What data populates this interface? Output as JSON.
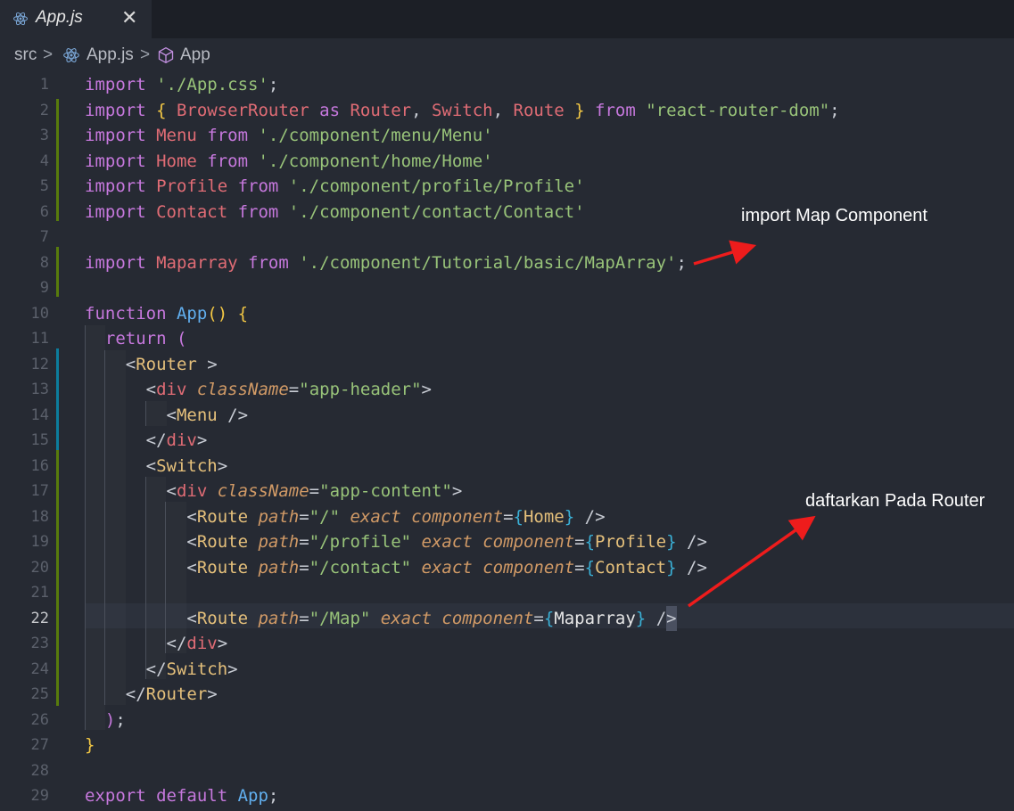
{
  "tab": {
    "label": "App.js",
    "close": "✕"
  },
  "breadcrumb": {
    "items": [
      "src",
      "App.js",
      "App"
    ],
    "separator": ">"
  },
  "editor": {
    "active_line": 22,
    "lines": [
      {
        "n": "1",
        "tokens": [
          [
            "kw",
            "import "
          ],
          [
            "str",
            "'./App.css'"
          ],
          [
            "pu",
            ";"
          ]
        ]
      },
      {
        "n": "2",
        "tokens": [
          [
            "kw",
            "import "
          ],
          [
            "br",
            "{ "
          ],
          [
            "id",
            "BrowserRouter "
          ],
          [
            "kw",
            "as "
          ],
          [
            "id",
            "Router"
          ],
          [
            "pu",
            ", "
          ],
          [
            "id",
            "Switch"
          ],
          [
            "pu",
            ", "
          ],
          [
            "id",
            "Route "
          ],
          [
            "br",
            "} "
          ],
          [
            "kw",
            "from "
          ],
          [
            "str",
            "\"react-router-dom\""
          ],
          [
            "pu",
            ";"
          ]
        ]
      },
      {
        "n": "3",
        "tokens": [
          [
            "kw",
            "import "
          ],
          [
            "id",
            "Menu "
          ],
          [
            "kw",
            "from "
          ],
          [
            "str",
            "'./component/menu/Menu'"
          ]
        ]
      },
      {
        "n": "4",
        "tokens": [
          [
            "kw",
            "import "
          ],
          [
            "id",
            "Home "
          ],
          [
            "kw",
            "from "
          ],
          [
            "str",
            "'./component/home/Home'"
          ]
        ]
      },
      {
        "n": "5",
        "tokens": [
          [
            "kw",
            "import "
          ],
          [
            "id",
            "Profile "
          ],
          [
            "kw",
            "from "
          ],
          [
            "str",
            "'./component/profile/Profile'"
          ]
        ]
      },
      {
        "n": "6",
        "tokens": [
          [
            "kw",
            "import "
          ],
          [
            "id",
            "Contact "
          ],
          [
            "kw",
            "from "
          ],
          [
            "str",
            "'./component/contact/Contact'"
          ]
        ]
      },
      {
        "n": "7",
        "tokens": []
      },
      {
        "n": "8",
        "tokens": [
          [
            "kw",
            "import "
          ],
          [
            "id",
            "Maparray "
          ],
          [
            "kw",
            "from "
          ],
          [
            "str",
            "'./component/Tutorial/basic/MapArray'"
          ],
          [
            "pu",
            ";"
          ]
        ]
      },
      {
        "n": "9",
        "tokens": []
      },
      {
        "n": "10",
        "tokens": [
          [
            "kw",
            "function "
          ],
          [
            "fn",
            "App"
          ],
          [
            "br",
            "() {"
          ]
        ]
      },
      {
        "n": "11",
        "tokens": [
          [
            "pu",
            "  "
          ],
          [
            "kw",
            "return ("
          ]
        ]
      },
      {
        "n": "12",
        "tokens": [
          [
            "pu",
            "    <"
          ],
          [
            "tag",
            "Router "
          ],
          [
            "pu",
            ">"
          ]
        ]
      },
      {
        "n": "13",
        "tokens": [
          [
            "pu",
            "      <"
          ],
          [
            "id",
            "div "
          ],
          [
            "attr",
            "className"
          ],
          [
            "pu",
            "="
          ],
          [
            "str",
            "\"app-header\""
          ],
          [
            "pu",
            ">"
          ]
        ]
      },
      {
        "n": "14",
        "tokens": [
          [
            "pu",
            "        <"
          ],
          [
            "tag",
            "Menu "
          ],
          [
            "pu",
            "/>"
          ]
        ]
      },
      {
        "n": "15",
        "tokens": [
          [
            "pu",
            "      </"
          ],
          [
            "id",
            "div"
          ],
          [
            "pu",
            ">"
          ]
        ]
      },
      {
        "n": "16",
        "tokens": [
          [
            "pu",
            "      <"
          ],
          [
            "tag",
            "Switch"
          ],
          [
            "pu",
            ">"
          ]
        ]
      },
      {
        "n": "17",
        "tokens": [
          [
            "pu",
            "        <"
          ],
          [
            "id",
            "div "
          ],
          [
            "attr",
            "className"
          ],
          [
            "pu",
            "="
          ],
          [
            "str",
            "\"app-content\""
          ],
          [
            "pu",
            ">"
          ]
        ]
      },
      {
        "n": "18",
        "tokens": [
          [
            "pu",
            "          <"
          ],
          [
            "tag",
            "Route "
          ],
          [
            "attr",
            "path"
          ],
          [
            "pu",
            "="
          ],
          [
            "str",
            "\"/\" "
          ],
          [
            "attr",
            "exact "
          ],
          [
            "attr",
            "component"
          ],
          [
            "pu",
            "="
          ],
          [
            "cbr",
            "{"
          ],
          [
            "tag",
            "Home"
          ],
          [
            "cbr",
            "}"
          ],
          [
            "pu",
            " />"
          ]
        ]
      },
      {
        "n": "19",
        "tokens": [
          [
            "pu",
            "          <"
          ],
          [
            "tag",
            "Route "
          ],
          [
            "attr",
            "path"
          ],
          [
            "pu",
            "="
          ],
          [
            "str",
            "\"/profile\" "
          ],
          [
            "attr",
            "exact "
          ],
          [
            "attr",
            "component"
          ],
          [
            "pu",
            "="
          ],
          [
            "cbr",
            "{"
          ],
          [
            "tag",
            "Profile"
          ],
          [
            "cbr",
            "}"
          ],
          [
            "pu",
            " />"
          ]
        ]
      },
      {
        "n": "20",
        "tokens": [
          [
            "pu",
            "          <"
          ],
          [
            "tag",
            "Route "
          ],
          [
            "attr",
            "path"
          ],
          [
            "pu",
            "="
          ],
          [
            "str",
            "\"/contact\" "
          ],
          [
            "attr",
            "exact "
          ],
          [
            "attr",
            "component"
          ],
          [
            "pu",
            "="
          ],
          [
            "cbr",
            "{"
          ],
          [
            "tag",
            "Contact"
          ],
          [
            "cbr",
            "}"
          ],
          [
            "pu",
            " />"
          ]
        ]
      },
      {
        "n": "21",
        "tokens": []
      },
      {
        "n": "22",
        "tokens": [
          [
            "pu",
            "          <"
          ],
          [
            "tag",
            "Route "
          ],
          [
            "attr",
            "path"
          ],
          [
            "pu",
            "="
          ],
          [
            "str",
            "\"/Map\" "
          ],
          [
            "attr",
            "exact "
          ],
          [
            "attr",
            "component"
          ],
          [
            "pu",
            "="
          ],
          [
            "cbr",
            "{"
          ],
          [
            "mp",
            "Maparray"
          ],
          [
            "cbr",
            "}"
          ],
          [
            "pu",
            " /"
          ],
          [
            "cursor",
            ">"
          ]
        ]
      },
      {
        "n": "23",
        "tokens": [
          [
            "pu",
            "        </"
          ],
          [
            "id",
            "div"
          ],
          [
            "pu",
            ">"
          ]
        ]
      },
      {
        "n": "24",
        "tokens": [
          [
            "pu",
            "      </"
          ],
          [
            "tag",
            "Switch"
          ],
          [
            "pu",
            ">"
          ]
        ]
      },
      {
        "n": "25",
        "tokens": [
          [
            "pu",
            "    </"
          ],
          [
            "tag",
            "Router"
          ],
          [
            "pu",
            ">"
          ]
        ]
      },
      {
        "n": "26",
        "tokens": [
          [
            "pu",
            "  "
          ],
          [
            "kw",
            ")"
          ],
          [
            "pu",
            ";"
          ]
        ]
      },
      {
        "n": "27",
        "tokens": [
          [
            "br",
            "}"
          ]
        ]
      },
      {
        "n": "28",
        "tokens": []
      },
      {
        "n": "29",
        "tokens": [
          [
            "kw",
            "export default "
          ],
          [
            "fn",
            "App"
          ],
          [
            "pu",
            ";"
          ]
        ]
      }
    ]
  },
  "annotations": {
    "import_note": "import Map Component",
    "router_note": "daftarkan Pada Router"
  },
  "colors": {
    "background": "#262a33",
    "keyword": "#c678dd",
    "identifier": "#e06c75",
    "string": "#98c379",
    "function": "#61afef",
    "tag": "#e5c07b",
    "attribute": "#d19a66",
    "arrow": "#ee1c1c",
    "gutter_added": "#587c0c",
    "gutter_modified": "#0c7d9d"
  },
  "icons": {
    "tab": "react-icon",
    "breadcrumb_file": "react-icon",
    "breadcrumb_symbol": "cube-icon"
  }
}
